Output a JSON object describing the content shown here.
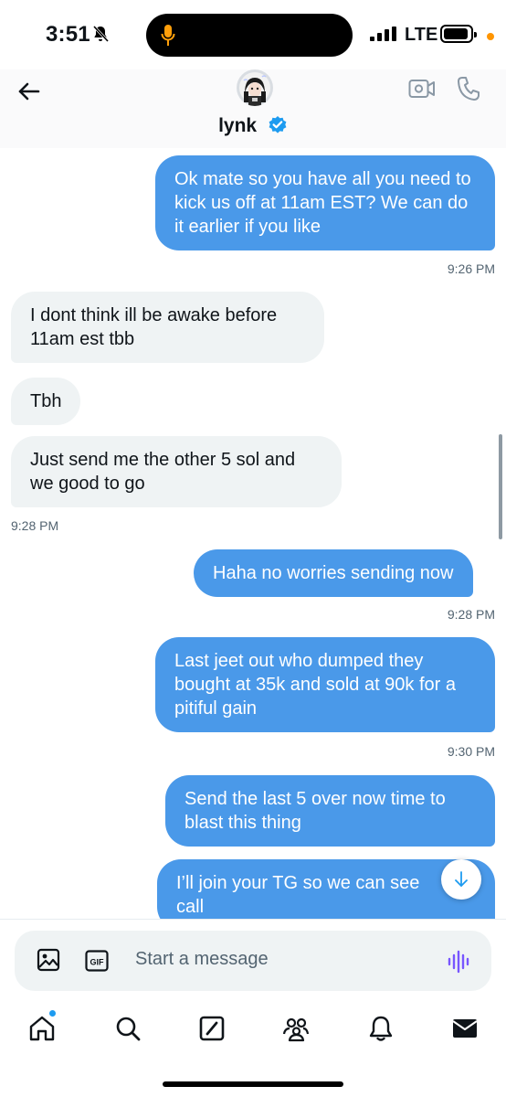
{
  "status": {
    "time": "3:51",
    "network": "LTE"
  },
  "header": {
    "name": "lynk"
  },
  "messages": [
    {
      "text": "Ok mate so you have all you need to kick us off at 11am EST? We can do it earlier if you like",
      "sender": "me",
      "time": "9:26 PM"
    },
    {
      "text": "I dont think ill be awake before 11am est tbb",
      "sender": "them"
    },
    {
      "text": "Tbh",
      "sender": "them"
    },
    {
      "text": "Just send me the other 5 sol and we good to go",
      "sender": "them",
      "time": "9:28 PM"
    },
    {
      "text": "Haha no worries sending now",
      "sender": "me",
      "time": "9:28 PM"
    },
    {
      "text": "Last jeet out who dumped they bought at 35k and sold at 90k for a pitiful gain",
      "sender": "me",
      "time": "9:30 PM"
    },
    {
      "text": "Send the last 5 over now time to blast this thing",
      "sender": "me"
    },
    {
      "text": "I’ll join your TG so we can see call",
      "sender": "me"
    }
  ],
  "composer": {
    "placeholder": "Start a message",
    "gif_label": "GIF"
  },
  "icons": {
    "back": "back-arrow-icon",
    "video": "video-call-icon",
    "phone": "phone-icon",
    "image": "image-icon",
    "gif": "gif-icon",
    "voice": "voice-waveform-icon",
    "scroll_down": "arrow-down-icon",
    "tabs": [
      "home-icon",
      "search-icon",
      "grok-icon",
      "communities-icon",
      "notifications-icon",
      "messages-icon"
    ]
  },
  "colors": {
    "outgoing_bubble": "#4a99e9",
    "incoming_bubble": "#eff3f4",
    "accent": "#1d9bf0",
    "voice_icon": "#7856ff"
  }
}
